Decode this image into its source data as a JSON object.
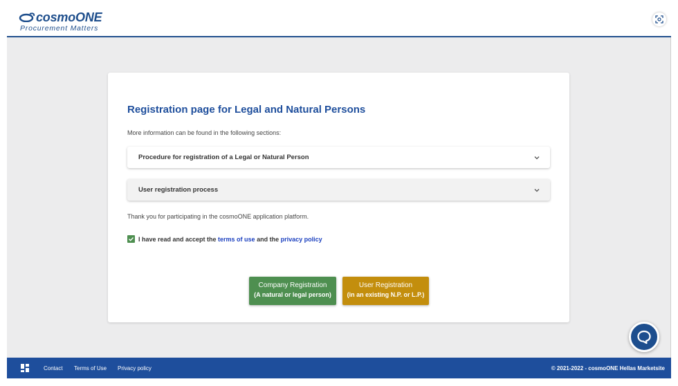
{
  "header": {
    "logo_name": "cosmoONE",
    "logo_tagline": "Procurement Matters",
    "scan_icon": "focus-scan-icon"
  },
  "main": {
    "title": "Registration page for Legal and Natural Persons",
    "intro": "More information can be found in the following sections:",
    "accordions": [
      {
        "label": "Procedure for registration of a Legal or Natural Person",
        "icon": "chevron-down-icon"
      },
      {
        "label": "User registration process",
        "icon": "chevron-down-icon"
      }
    ],
    "thanks": "Thank you for participating in the cosmoONE application platform.",
    "consent": {
      "checked": true,
      "text_before": "I have read and accept the ",
      "terms_link": "terms of use",
      "text_middle": " and the ",
      "privacy_link": "privacy policy"
    },
    "buttons": {
      "company": {
        "line1": "Company Registration",
        "line2": "(A natural or legal person)"
      },
      "user": {
        "line1": "User Registration",
        "line2": "(in an existing N.P. or L.P.)"
      }
    }
  },
  "chat": {
    "icon": "chat-bubble-icon"
  },
  "footer": {
    "menu_icon": "grid-icon",
    "links": [
      "Contact",
      "Terms of Use",
      "Privacy policy"
    ],
    "copyright": "© 2021-2022 - cosmoONE Hellas Marketsite"
  },
  "colors": {
    "brand_blue": "#1e4e9c",
    "green_button": "#4e8f50",
    "gold_button": "#c38e0d",
    "link": "#1a3fbf"
  }
}
